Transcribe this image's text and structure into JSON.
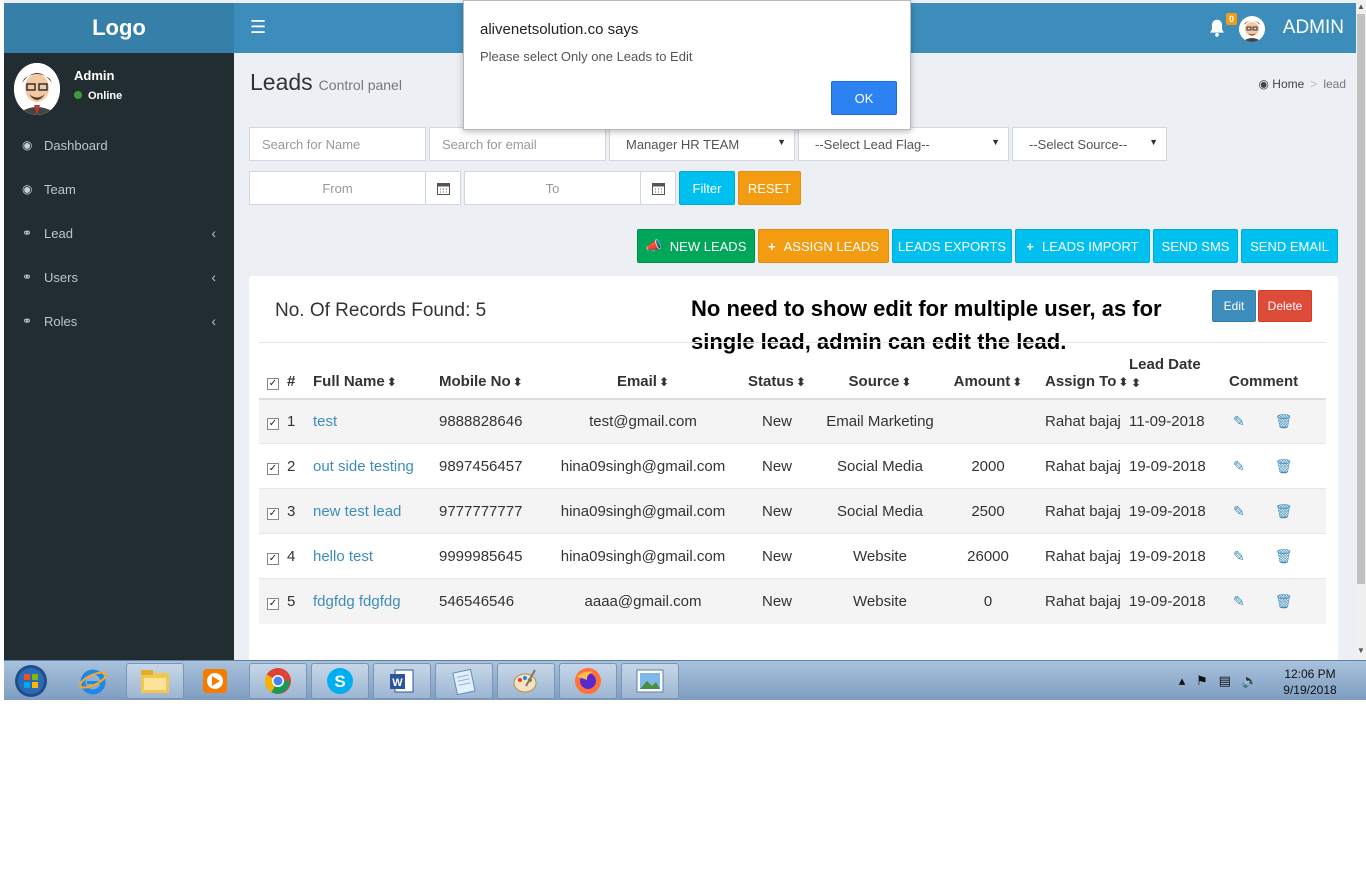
{
  "header": {
    "logo": "Logo",
    "menu_icon": "hamburger-icon",
    "notification_count": "0",
    "user_name": "ADMIN"
  },
  "sidebar": {
    "user": {
      "name": "Admin",
      "status": "Online"
    },
    "items": [
      {
        "label": "Dashboard",
        "icon": "dashboard-icon"
      },
      {
        "label": "Team",
        "icon": "dashboard-icon"
      },
      {
        "label": "Lead",
        "icon": "link-icon"
      },
      {
        "label": "Users",
        "icon": "link-icon"
      },
      {
        "label": "Roles",
        "icon": "link-icon"
      }
    ]
  },
  "page": {
    "title": "Leads",
    "subtitle": "Control panel",
    "breadcrumb": {
      "home": "Home",
      "current": "lead"
    }
  },
  "filters": {
    "name_placeholder": "Search for Name",
    "email_placeholder": "Search for email",
    "manager": "Manager HR TEAM",
    "lead_flag": "--Select Lead Flag--",
    "source": "--Select Source--",
    "from_placeholder": "From",
    "to_placeholder": "To",
    "filter_label": "Filter",
    "reset_label": "RESET"
  },
  "actions": {
    "new_leads": "NEW LEADS",
    "assign_leads": "ASSIGN LEADS",
    "leads_exports": "LEADS EXPORTS",
    "leads_import": "LEADS IMPORT",
    "send_sms": "SEND SMS",
    "send_email": "SEND EMAIL"
  },
  "table": {
    "records_label": "No. Of Records Found: 5",
    "annotation": "No need to show edit for multiple user, as for single lead, admin can edit the lead.",
    "edit_label": "Edit",
    "delete_label": "Delete",
    "columns": [
      "#",
      "Full Name",
      "Mobile No",
      "Email",
      "Status",
      "Source",
      "Amount",
      "Assign To",
      "Lead Date",
      "Comment"
    ],
    "rows": [
      {
        "num": "1",
        "name": "test",
        "mobile": "9888828646",
        "email": "test@gmail.com",
        "status": "New",
        "source": "Email Marketing",
        "amount": "",
        "assign": "Rahat bajaj",
        "date": "11-09-2018"
      },
      {
        "num": "2",
        "name": "out side testing",
        "mobile": "9897456457",
        "email": "hina09singh@gmail.com",
        "status": "New",
        "source": "Social Media",
        "amount": "2000",
        "assign": "Rahat bajaj",
        "date": "19-09-2018"
      },
      {
        "num": "3",
        "name": "new test lead",
        "mobile": "9777777777",
        "email": "hina09singh@gmail.com",
        "status": "New",
        "source": "Social Media",
        "amount": "2500",
        "assign": "Rahat bajaj",
        "date": "19-09-2018"
      },
      {
        "num": "4",
        "name": "hello test",
        "mobile": "9999985645",
        "email": "hina09singh@gmail.com",
        "status": "New",
        "source": "Website",
        "amount": "26000",
        "assign": "Rahat bajaj",
        "date": "19-09-2018"
      },
      {
        "num": "5",
        "name": "fdgfdg fdgfdg",
        "mobile": "546546546",
        "email": "aaaa@gmail.com",
        "status": "New",
        "source": "Website",
        "amount": "0",
        "assign": "Rahat bajaj",
        "date": "19-09-2018"
      }
    ]
  },
  "dialog": {
    "title": "alivenetsolution.co says",
    "message": "Please select Only one Leads to Edit",
    "ok_label": "OK"
  },
  "taskbar": {
    "time": "12:06 PM",
    "date": "9/19/2018",
    "apps": [
      "start-orb-icon",
      "internet-explorer-icon",
      "file-explorer-icon",
      "media-player-icon",
      "chrome-icon",
      "skype-icon",
      "word-icon",
      "notepad-icon",
      "paint-icon",
      "firefox-icon",
      "photo-viewer-icon"
    ]
  },
  "colors": {
    "header": "#3c8dbc",
    "logo_bg": "#367fa9",
    "sidebar": "#222d32",
    "success": "#00a65a",
    "warning": "#f39c12",
    "info": "#00c0ef",
    "danger": "#dd4b39"
  }
}
